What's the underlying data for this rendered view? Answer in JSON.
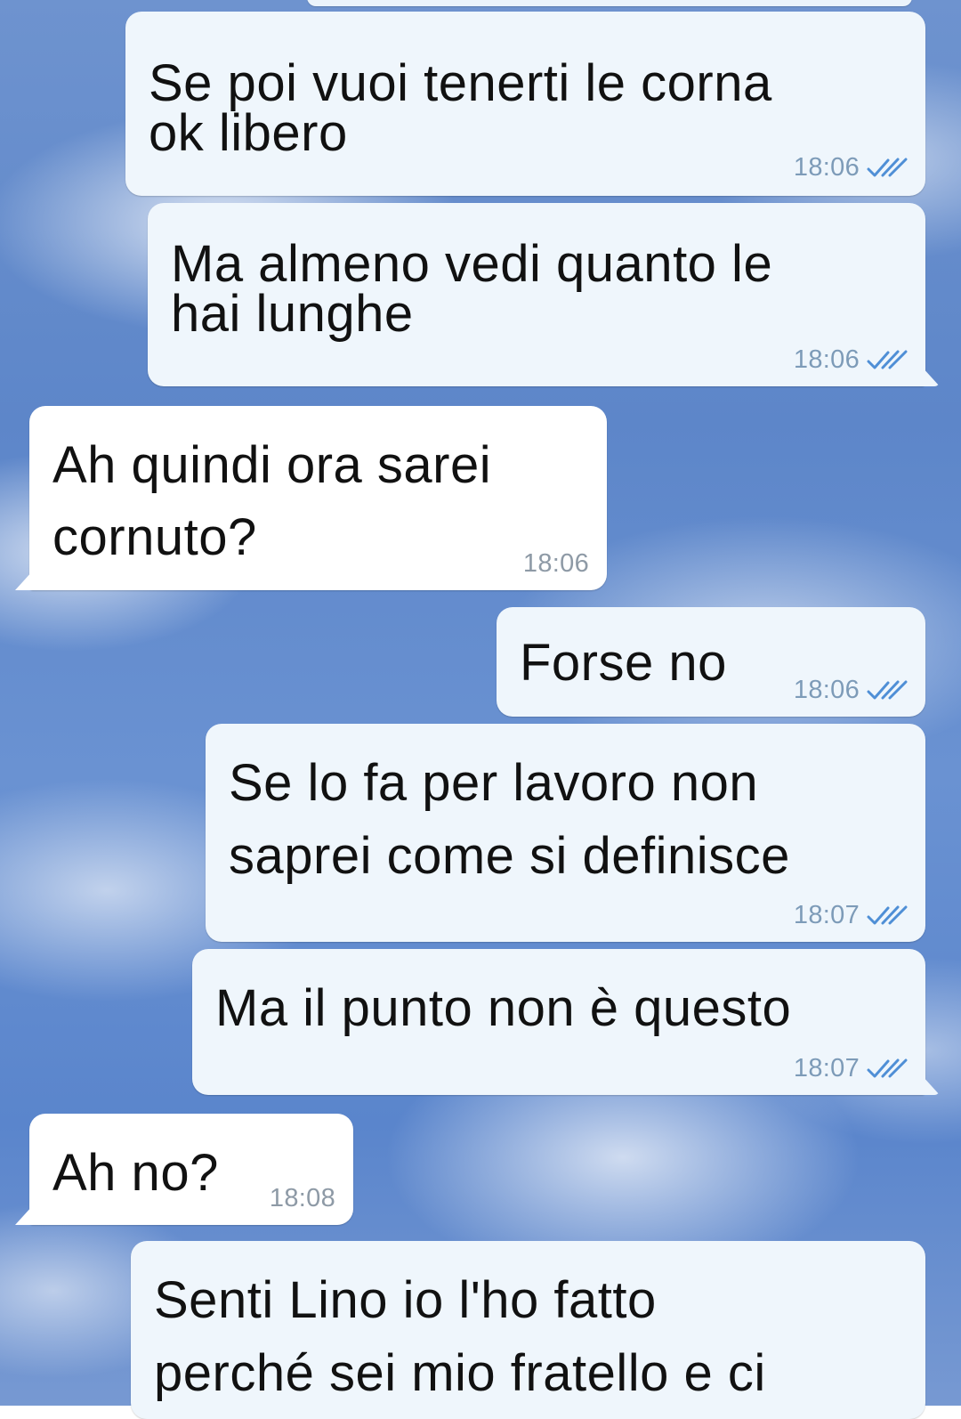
{
  "colors": {
    "outgoing_bubble": "#eff6fc",
    "incoming_bubble": "#ffffff",
    "check_color": "#4f8fd6",
    "time_color": "#8e9aa6"
  },
  "messages": [
    {
      "direction": "out",
      "lines": [
        "Se poi vuoi tenerti le corna",
        "ok libero"
      ],
      "time": "18:06",
      "status": "read-double-check-icon"
    },
    {
      "direction": "out",
      "lines": [
        "Ma almeno vedi quanto le",
        "hai lunghe"
      ],
      "time": "18:06",
      "status": "read-double-check-icon"
    },
    {
      "direction": "in",
      "lines": [
        "Ah quindi ora sarei",
        "cornuto?"
      ],
      "time": "18:06"
    },
    {
      "direction": "out",
      "lines": [
        "Forse no"
      ],
      "time": "18:06",
      "status": "read-double-check-icon"
    },
    {
      "direction": "out",
      "lines": [
        "Se lo fa per lavoro non",
        "saprei come si definisce"
      ],
      "time": "18:07",
      "status": "read-double-check-icon"
    },
    {
      "direction": "out",
      "lines": [
        "Ma il punto non è questo"
      ],
      "time": "18:07",
      "status": "read-double-check-icon"
    },
    {
      "direction": "in",
      "lines": [
        "Ah no?"
      ],
      "time": "18:08"
    },
    {
      "direction": "out",
      "lines": [
        "Senti Lino io l'ho fatto",
        "perché sei mio fratello e ci"
      ],
      "time": ""
    }
  ]
}
